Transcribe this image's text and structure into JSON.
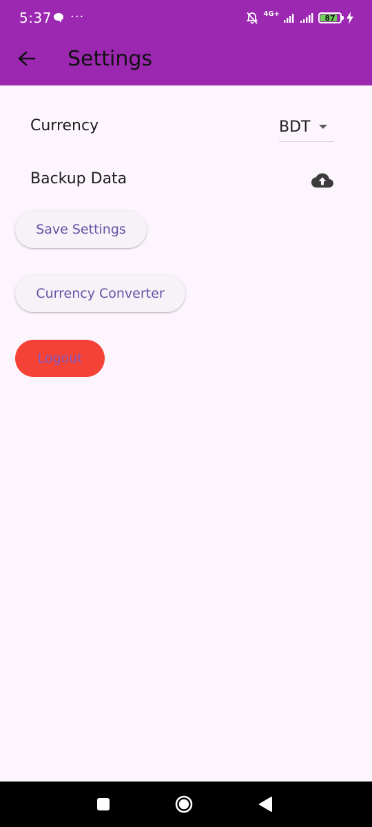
{
  "status_bar": {
    "time": "5:37",
    "dots": "···",
    "network_type": "4G+",
    "battery": "87",
    "battery_level": 0.87
  },
  "app_bar": {
    "title": "Settings",
    "background_color": "#9C27B0",
    "back_icon": "arrow-back-icon"
  },
  "settings": {
    "currency": {
      "label": "Currency",
      "selected": "BDT"
    },
    "backup": {
      "label": "Backup Data",
      "icon": "cloud-upload-icon"
    }
  },
  "buttons": {
    "save": "Save Settings",
    "converter": "Currency Converter",
    "logout": "Logout",
    "logout_color": "#F44336",
    "accent_color": "#6750A4"
  },
  "nav_bar": {
    "recent_icon": "square-icon",
    "home_icon": "circle-home-icon",
    "back_icon": "triangle-back-icon"
  }
}
